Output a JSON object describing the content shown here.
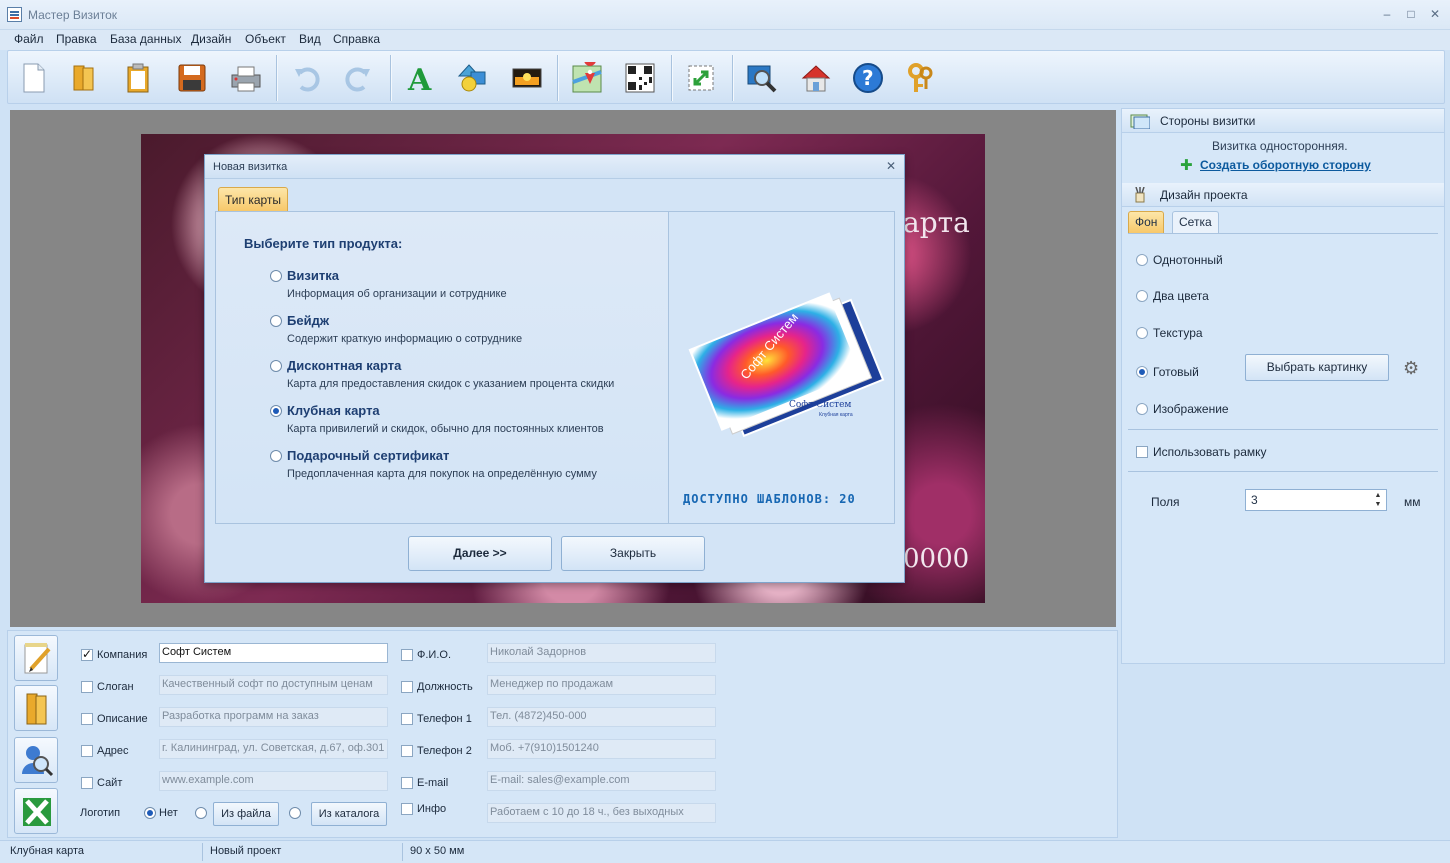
{
  "window": {
    "title": "Мастер Визиток"
  },
  "menu": [
    "Файл",
    "Правка",
    "База данных",
    "Дизайн",
    "Объект",
    "Вид",
    "Справка"
  ],
  "toolbar": {
    "icons": [
      "new-document-icon",
      "open-folder-icon",
      "clipboard-icon",
      "save-icon",
      "print-icon",
      "undo-icon",
      "redo-icon",
      "text-icon",
      "shapes-icon",
      "image-icon",
      "map-icon",
      "qr-code-icon",
      "fit-icon",
      "zoom-icon",
      "home-icon",
      "help-icon",
      "keys-icon"
    ]
  },
  "card": {
    "text_partial_1": "арта",
    "text_partial_2": "0000"
  },
  "dialog": {
    "title": "Новая визитка",
    "tab": "Тип карты",
    "prompt": "Выберите тип продукта:",
    "options": [
      {
        "label": "Визитка",
        "desc": "Информация об организации и сотруднике",
        "selected": false
      },
      {
        "label": "Бейдж",
        "desc": "Содержит краткую информацию о сотруднике",
        "selected": false
      },
      {
        "label": "Дисконтная карта",
        "desc": "Карта для предоставления скидок с указанием процента скидки",
        "selected": false
      },
      {
        "label": "Клубная карта",
        "desc": "Карта привилегий и скидок, обычно для постоянных клиентов",
        "selected": true
      },
      {
        "label": "Подарочный сертификат",
        "desc": "Предоплаченная карта для покупок на определённую сумму",
        "selected": false
      }
    ],
    "preview": {
      "company": "Софт Систем",
      "subtitle": "Клубная карта"
    },
    "templates_available": "ДОСТУПНО ШАБЛОНОВ: 20",
    "next_button": "Далее >>",
    "close_button": "Закрыть"
  },
  "right_panel": {
    "sides_header": "Стороны визитки",
    "sides_text": "Визитка односторонняя.",
    "create_back_link": "Создать оборотную сторону",
    "design_header": "Дизайн проекта",
    "tabs": [
      "Фон",
      "Сетка"
    ],
    "bg_options": [
      "Однотонный",
      "Два цвета",
      "Текстура",
      "Готовый",
      "Изображение"
    ],
    "bg_selected": "Готовый",
    "pick_image_button": "Выбрать картинку",
    "use_frame_label": "Использовать рамку",
    "margins_label": "Поля",
    "margins_value": "3",
    "margins_unit": "мм"
  },
  "form": {
    "left": [
      {
        "label": "Компания",
        "value": "Софт Систем",
        "checked": true
      },
      {
        "label": "Слоган",
        "value": "Качественный софт по доступным ценам",
        "checked": false
      },
      {
        "label": "Описание",
        "value": "Разработка программ на заказ",
        "checked": false
      },
      {
        "label": "Адрес",
        "value": "г. Калининград, ул. Советская, д.67, оф.301",
        "checked": false
      },
      {
        "label": "Сайт",
        "value": "www.example.com",
        "checked": false
      }
    ],
    "right": [
      {
        "label": "Ф.И.О.",
        "value": "Николай Задорнов",
        "checked": false
      },
      {
        "label": "Должность",
        "value": "Менеджер по продажам",
        "checked": false
      },
      {
        "label": "Телефон 1",
        "value": "Тел. (4872)450-000",
        "checked": false
      },
      {
        "label": "Телефон 2",
        "value": "Моб. +7(910)1501240",
        "checked": false
      },
      {
        "label": "E-mail",
        "value": "E-mail: sales@example.com",
        "checked": false
      },
      {
        "label": "Инфо",
        "value": "Работаем с 10 до 18 ч., без выходных",
        "checked": false
      }
    ],
    "logo_label": "Логотип",
    "logo_none": "Нет",
    "logo_from_file": "Из файла",
    "logo_from_catalog": "Из каталога"
  },
  "status": [
    "Клубная карта",
    "Новый проект",
    "90 x 50 мм"
  ]
}
